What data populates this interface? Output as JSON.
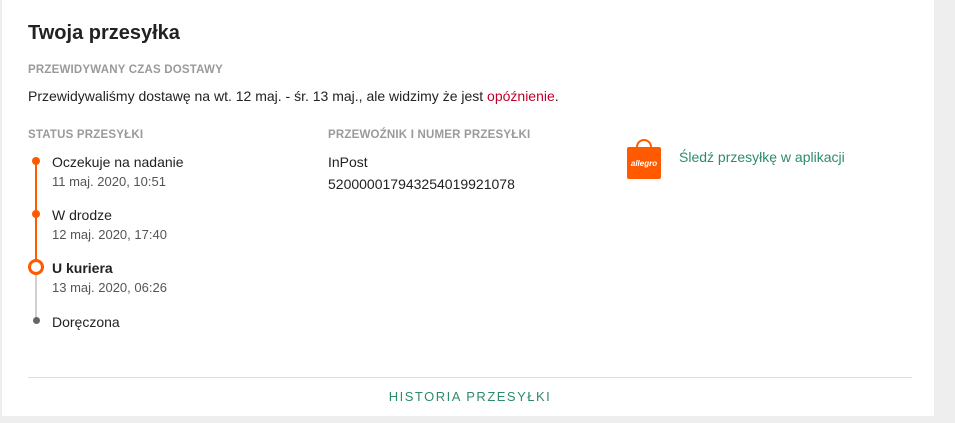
{
  "card": {
    "title": "Twoja przesyłka",
    "eta": {
      "label": "PRZEWIDYWANY CZAS DOSTAWY",
      "text_before": "Przewidywaliśmy dostawę na wt. 12 maj. - śr. 13 maj., ale widzimy że jest ",
      "delay_word": "opóźnienie",
      "text_after": "."
    },
    "status": {
      "label": "STATUS PRZESYŁKI",
      "steps": [
        {
          "title": "Oczekuje na nadanie",
          "date": "11 maj. 2020, 10:51"
        },
        {
          "title": "W drodze",
          "date": "12 maj. 2020, 17:40"
        },
        {
          "title": "U kuriera",
          "date": "13 maj. 2020, 06:26"
        },
        {
          "title": "Doręczona"
        }
      ]
    },
    "carrier": {
      "label": "PRZEWOŹNIK I NUMER PRZESYŁKI",
      "name": "InPost",
      "tracking_number": "520000017943254019921078"
    },
    "app": {
      "logo_text": "allegro",
      "link_label": "Śledź przesyłkę w aplikacji"
    },
    "history_link": "HISTORIA PRZESYŁKI"
  },
  "colors": {
    "accent_orange": "#ff5a00",
    "link_green": "#2d8b6d",
    "delay_red": "#c0002a"
  }
}
